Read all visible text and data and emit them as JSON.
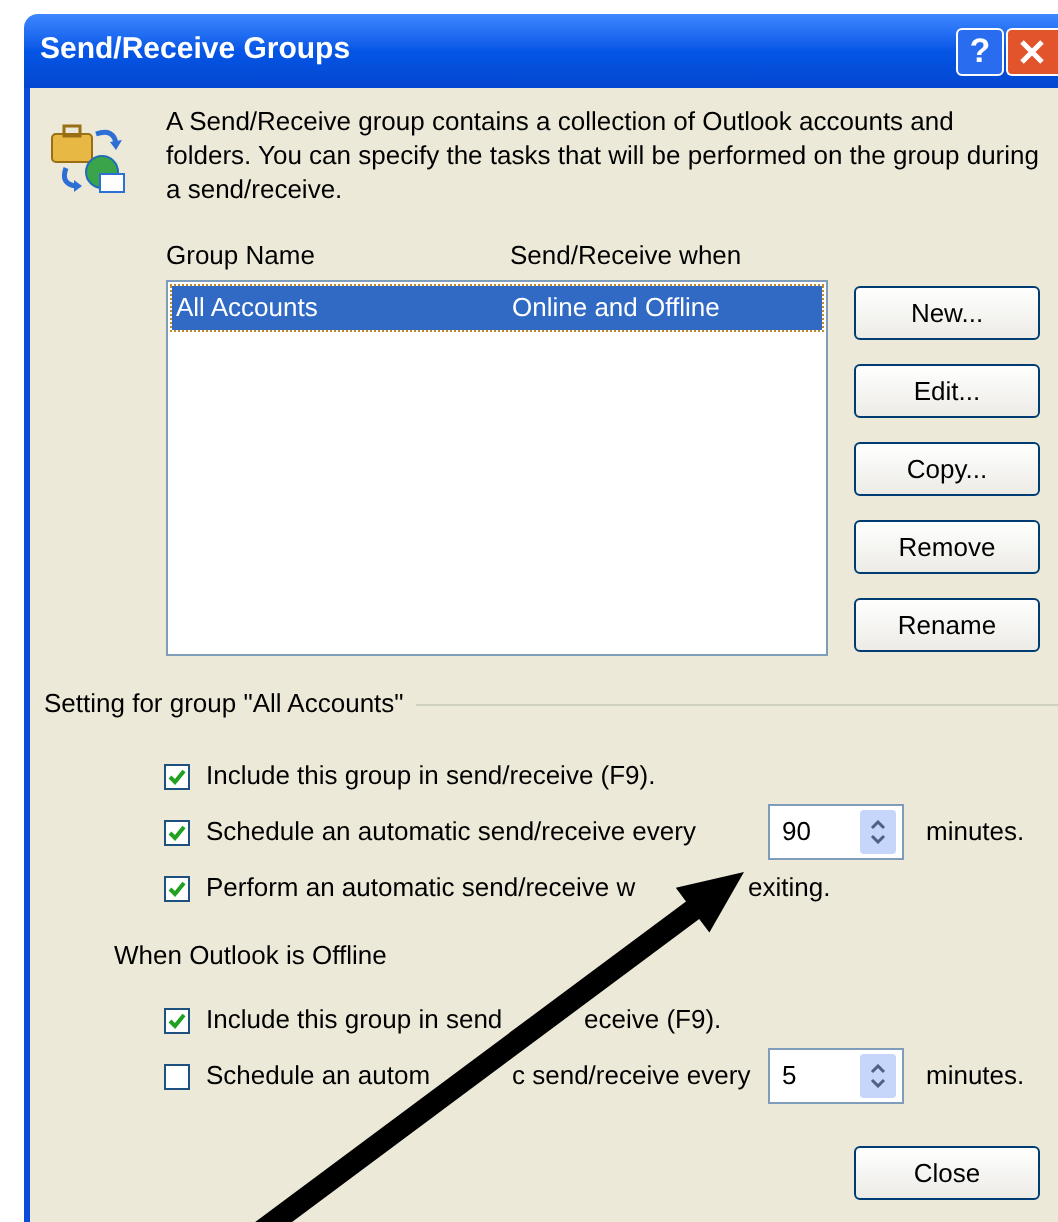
{
  "window": {
    "title": "Send/Receive Groups",
    "help_button": "?"
  },
  "description": "A Send/Receive group contains a collection of Outlook accounts and folders. You can specify the tasks that will be performed on the group during a send/receive.",
  "list": {
    "columns": [
      "Group Name",
      "Send/Receive when"
    ],
    "rows": [
      {
        "cells": [
          "All Accounts",
          "Online and Offline"
        ],
        "selected": true
      }
    ]
  },
  "side_buttons": [
    "New...",
    "Edit...",
    "Copy...",
    "Remove",
    "Rename"
  ],
  "settings_group": {
    "title": "Setting for group \"All Accounts\"",
    "online_options": [
      {
        "label_parts": [
          "Include this group in send/receive (F9)."
        ],
        "checked": true
      },
      {
        "label_parts": [
          "Schedule an automatic send/receive every"
        ],
        "checked": true,
        "spin": {
          "value": "90",
          "unit": "minutes."
        }
      },
      {
        "label_parts": [
          "Perform an automatic send/receive w",
          "exiting."
        ],
        "checked": true
      }
    ],
    "offline_title": "When Outlook is Offline",
    "offline_options": [
      {
        "label_parts": [
          "Include this group in send",
          "eceive (F9)."
        ],
        "checked": true
      },
      {
        "label_parts": [
          "Schedule an autom",
          "c send/receive every"
        ],
        "checked": false,
        "spin": {
          "value": "5",
          "unit": "minutes."
        }
      }
    ]
  },
  "close_button": "Close"
}
